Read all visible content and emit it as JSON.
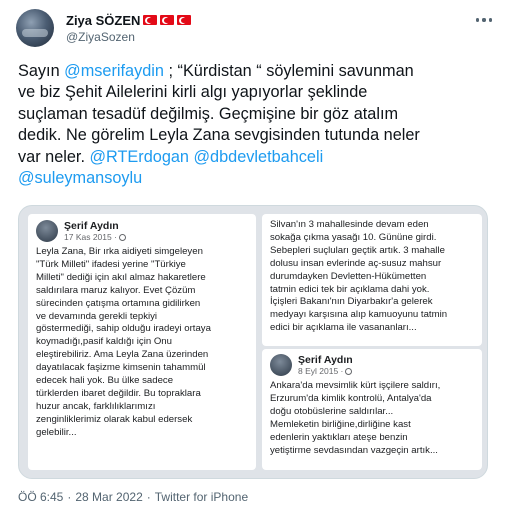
{
  "author": {
    "display_name": "Ziya SÖZEN",
    "handle": "@ZiyaSozen",
    "flag_count": 3,
    "flag_color": "#e30a17"
  },
  "more_icon": "more-horizontal-icon",
  "tweet": {
    "segments_line1": [
      {
        "text": "Sayın ",
        "type": "text"
      },
      {
        "text": "@mserifaydin",
        "type": "mention"
      },
      {
        "text": " ; “Kürdistan “ söylemini savunman",
        "type": "text"
      }
    ],
    "line2": "ve biz Şehit Ailelerini kirli algı yapıyorlar şeklinde",
    "line3": "suçlaman tesadüf değilmiş. Geçmişine bir göz atalım",
    "line4": "dedik. Ne görelim Leyla Zana sevgisinden tutunda neler",
    "line5_prefix": "var neler. ",
    "mention_erdogan": "@RTErdogan",
    "mention_bahceli": "@dbdevletbahceli",
    "mention_soylu": "@suleymansoylu"
  },
  "media": {
    "left_post": {
      "author": "Şerif Aydın",
      "date": "17 Kas 2015 ·",
      "lines": [
        "Leyla Zana, Bir ırka aidiyeti simgeleyen",
        "\"Türk Milleti\" ifadesi yerine \"Türkiye",
        "Milleti\" dediği için akıl almaz hakaretlere",
        "saldırılara maruz kalıyor. Evet Çözüm",
        "sürecinden çatışma ortamına gidilirken",
        "ve devamında gerekli tepkiyi",
        "göstermediği, sahip olduğu iradeyi ortaya",
        "koymadığı,pasif kaldığı için Onu",
        "eleştirebiliriz. Ama Leyla Zana üzerinden",
        "dayatılacak faşizme kimsenin tahammül",
        "edecek hali yok. Bu ülke sadece",
        "türklerden ibaret değildir. Bu topraklara",
        "huzur ancak, farklılıklarımızı",
        "zenginliklerimiz olarak kabul edersek",
        "gelebilir..."
      ]
    },
    "right_top_lines": [
      "Silvan'ın 3 mahallesinde devam eden",
      "sokağa çıkma yasağı 10. Gününe girdi.",
      "Sebepleri suçluları geçtik artık. 3 mahalle",
      "dolusu insan evlerinde aç-susuz mahsur",
      "durumdayken Devletten-Hükümetten",
      "tatmin edici tek bir açıklama dahi yok.",
      "İçişleri Bakanı'nın Diyarbakır'a gelerek",
      "medyayı karşısına alıp kamuoyunu tatmin",
      "edici bir açıklama ile vasananları..."
    ],
    "right_bottom_post": {
      "author": "Şerif Aydın",
      "date": "8 Eyl 2015 ·",
      "lines": [
        "Ankara'da mevsimlik kürt işçilere saldırı,",
        "Erzurum'da kimlik kontrolü, Antalya'da",
        "doğu otobüslerine saldırılar...",
        "Memleketin birliğine,dirliğine kast",
        "edenlerin yaktıkları ateşe benzin",
        "yetiştirme sevdasından vazgeçin artık..."
      ]
    }
  },
  "footer": {
    "time": "ÖÖ 6:45",
    "separator": "·",
    "date": "28 Mar 2022",
    "source": "Twitter for iPhone"
  }
}
